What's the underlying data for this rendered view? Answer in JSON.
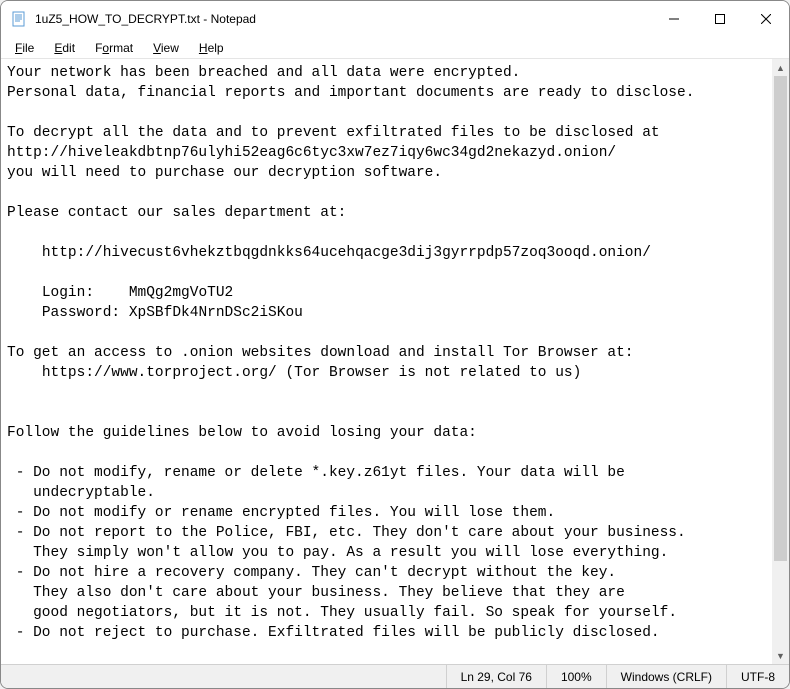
{
  "titlebar": {
    "title": "1uZ5_HOW_TO_DECRYPT.txt - Notepad"
  },
  "menubar": {
    "file": "File",
    "edit": "Edit",
    "format": "Format",
    "view": "View",
    "help": "Help"
  },
  "content": "Your network has been breached and all data were encrypted.\nPersonal data, financial reports and important documents are ready to disclose.\n\nTo decrypt all the data and to prevent exfiltrated files to be disclosed at\nhttp://hiveleakdbtnp76ulyhi52eag6c6tyc3xw7ez7iqy6wc34gd2nekazyd.onion/\nyou will need to purchase our decryption software.\n\nPlease contact our sales department at:\n\n    http://hivecust6vhekztbqgdnkks64ucehqacge3dij3gyrrpdp57zoq3ooqd.onion/\n\n    Login:    MmQg2mgVoTU2\n    Password: XpSBfDk4NrnDSc2iSKou\n\nTo get an access to .onion websites download and install Tor Browser at:\n    https://www.torproject.org/ (Tor Browser is not related to us)\n\n\nFollow the guidelines below to avoid losing your data:\n\n - Do not modify, rename or delete *.key.z61yt files. Your data will be\n   undecryptable.\n - Do not modify or rename encrypted files. You will lose them.\n - Do not report to the Police, FBI, etc. They don't care about your business.\n   They simply won't allow you to pay. As a result you will lose everything.\n - Do not hire a recovery company. They can't decrypt without the key.\n   They also don't care about your business. They believe that they are\n   good negotiators, but it is not. They usually fail. So speak for yourself.\n - Do not reject to purchase. Exfiltrated files will be publicly disclosed.",
  "statusbar": {
    "position": "Ln 29, Col 76",
    "zoom": "100%",
    "eol": "Windows (CRLF)",
    "encoding": "UTF-8"
  }
}
